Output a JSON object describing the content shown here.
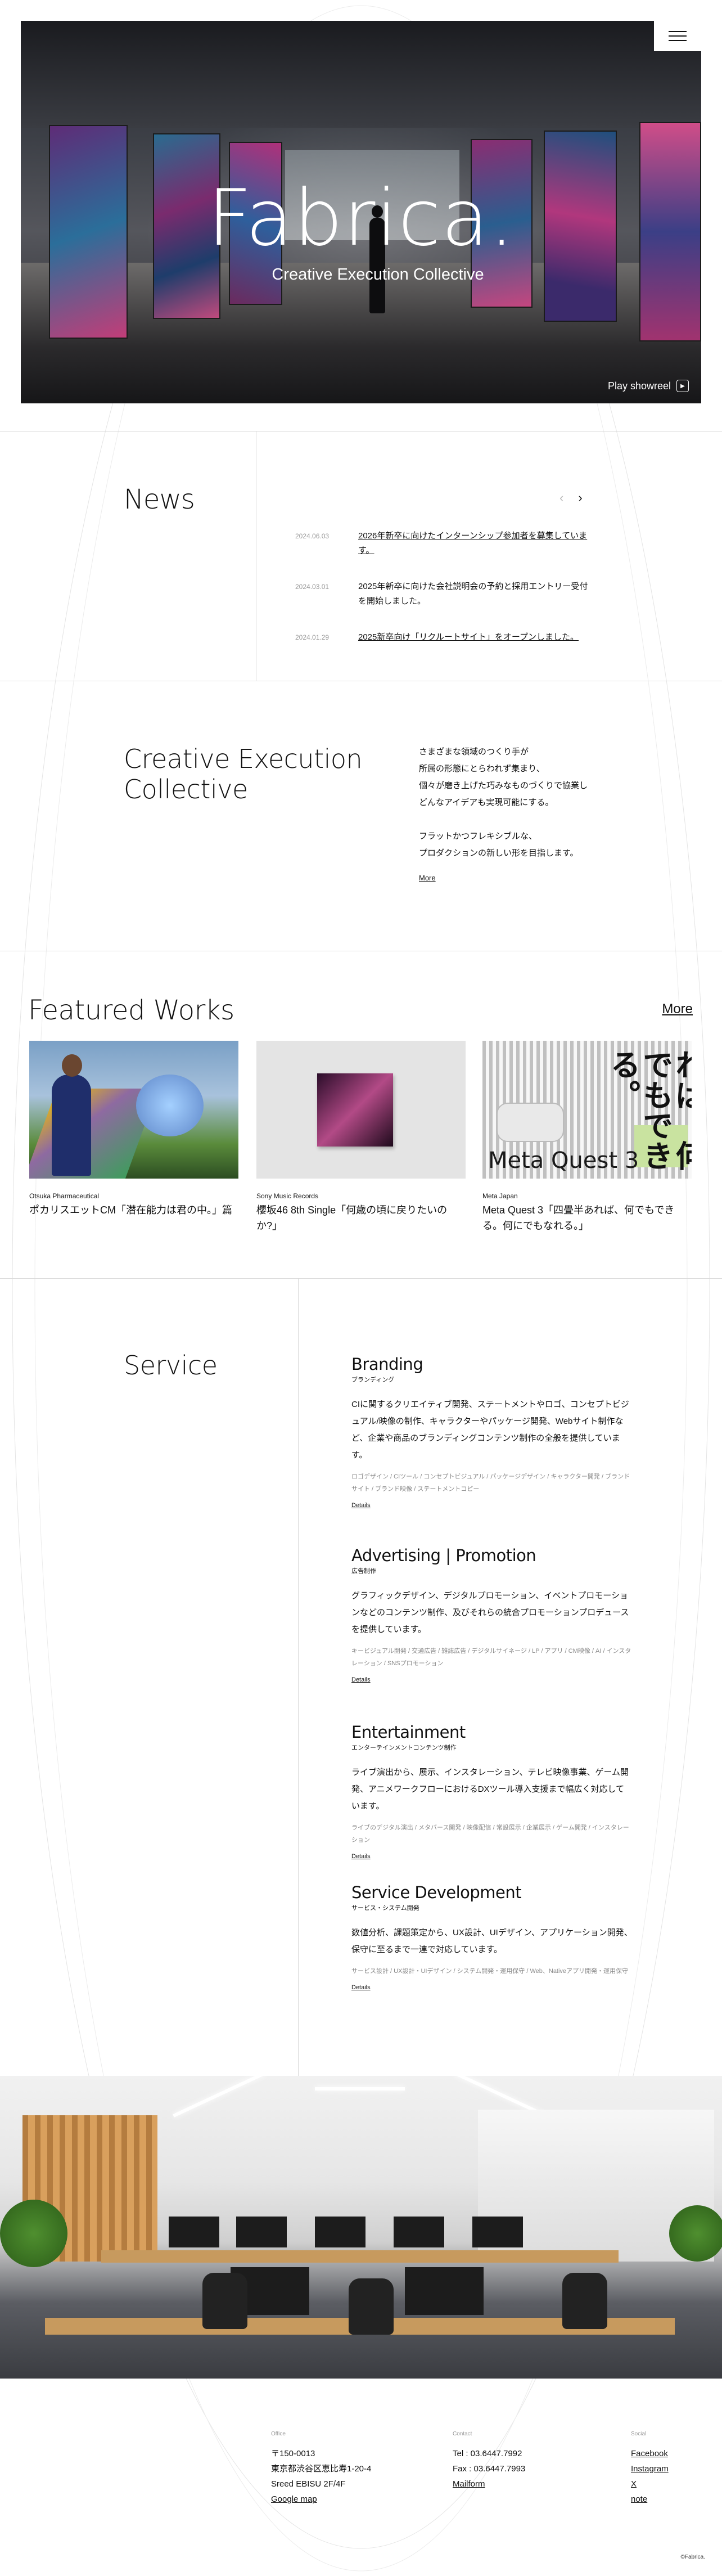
{
  "hero": {
    "title": "Fabrica.",
    "subtitle": "Creative Execution Collective",
    "play_label": "Play showreel"
  },
  "menu": {
    "icon": "hamburger-menu-icon"
  },
  "news": {
    "title": "News",
    "prev_icon": "chevron-left-icon",
    "next_icon": "chevron-right-icon",
    "items": [
      {
        "date": "2024.06.03",
        "text": "2026年新卒に向けたインターンシップ参加者を募集しています。"
      },
      {
        "date": "2024.03.01",
        "text": "2025年新卒に向けた会社説明会の予約と採用エントリー受付を開始しました。"
      },
      {
        "date": "2024.01.29",
        "text": "2025新卒向け「リクルートサイト」をオープンしました。"
      }
    ]
  },
  "creative": {
    "title_line1": "Creative Execution",
    "title_line2": "Collective",
    "para1_l1": "さまざまな領域のつくり手が",
    "para1_l2": "所属の形態にとらわれず集まり、",
    "para1_l3": "個々が磨き上げた巧みなものづくりで協業し",
    "para1_l4": "どんなアイデアも実現可能にする。",
    "para2_l1": "フラットかつフレキシブルな、",
    "para2_l2": "プロダクションの新しい形を目指します。",
    "more": "More"
  },
  "featured": {
    "title": "Featured Works",
    "more": "More",
    "works": [
      {
        "client": "Otsuka Pharmaceutical",
        "title": "ポカリスエットCM「潜在能力は君の中。」篇"
      },
      {
        "client": "Sony Music Records",
        "title": "櫻坂46 8th Single「何歳の頃に戻りたいのか?」"
      },
      {
        "client": "Meta Japan",
        "title": "Meta Quest 3「四畳半あれば、何でもできる。何にでもなれる。」",
        "poster_logo": "Meta Quest 3",
        "poster_copy": "四畳半あれば、何でもできる。"
      }
    ]
  },
  "service": {
    "title": "Service",
    "items": [
      {
        "name": "Branding",
        "jp": "ブランディング",
        "desc": "CIに関するクリエイティブ開発、ステートメントやロゴ、コンセプトビジュアル/映像の制作、キャラクターやパッケージ開発、Webサイト制作など、企業や商品のブランディングコンテンツ制作の全般を提供しています。",
        "tags": "ロゴデザイン / CIツール / コンセプトビジュアル / パッケージデザイン / キャラクター開発 / ブランドサイト / ブランド映像 / ステートメントコピー",
        "details": "Details"
      },
      {
        "name": "Advertising | Promotion",
        "jp": "広告制作",
        "desc": "グラフィックデザイン、デジタルプロモーション、イベントプロモーションなどのコンテンツ制作、及びそれらの統合プロモーションプロデュースを提供しています。",
        "tags": "キービジュアル開発 / 交通広告 / 雑誌広告 / デジタルサイネージ / LP / アプリ / CM映像 / AI / インスタレーション / SNSプロモーション",
        "details": "Details"
      },
      {
        "name": "Entertainment",
        "jp": "エンターテインメントコンテンツ制作",
        "desc": "ライブ演出から、展示、インスタレーション、テレビ映像事業、ゲーム開発、アニメワークフローにおけるDXツール導入支援まで幅広く対応しています。",
        "tags": "ライブのデジタル演出 / メタバース開発 / 映像配信 / 常設展示 / 企業展示 / ゲーム開発 / インスタレーション",
        "details": "Details"
      },
      {
        "name": "Service Development",
        "jp": "サービス・システム開発",
        "desc": "数値分析、課題策定から、UX設計、UIデザイン、アプリケーション開発、保守に至るまで一連で対応しています。",
        "tags": "サービス設計 / UX設計・UIデザイン / システム開発・運用保守 / Web、Nativeアプリ開発・運用保守",
        "details": "Details"
      }
    ]
  },
  "footer": {
    "office_label": "Office",
    "zip": "〒150-0013",
    "address1": "東京都渋谷区恵比寿1-20-4",
    "address2": "Sreed EBISU 2F/4F",
    "map": "Google map",
    "contact_label": "Contact",
    "tel": "Tel : 03.6447.7992",
    "fax": "Fax : 03.6447.7993",
    "mail": "Mailform",
    "social_label": "Social",
    "facebook": "Facebook",
    "instagram": "Instagram",
    "x": "X",
    "note": "note",
    "copyright": "©Fabrica."
  }
}
